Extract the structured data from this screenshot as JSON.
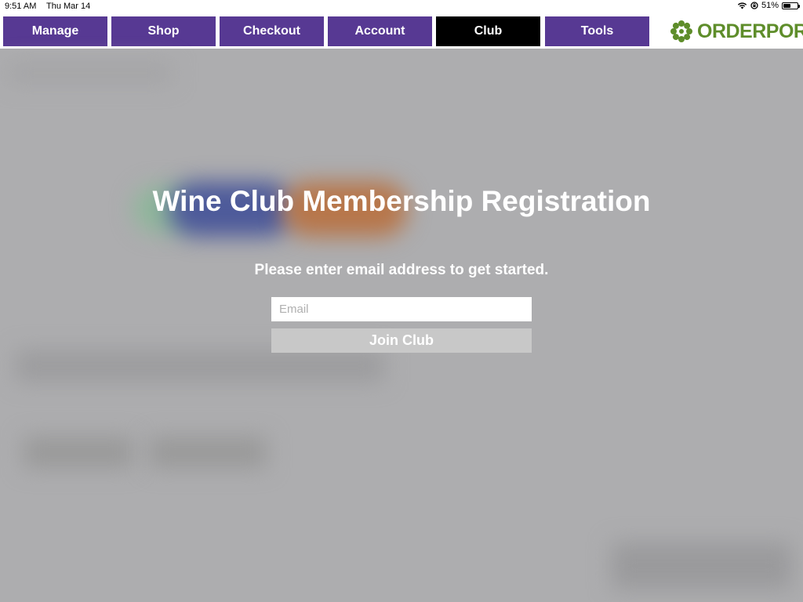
{
  "status_bar": {
    "time": "9:51 AM",
    "date": "Thu Mar 14",
    "battery_pct": "51%",
    "battery_level": 0.51,
    "wifi_icon": "wifi-icon",
    "rotation_lock_icon": "rotation-lock-icon"
  },
  "nav": {
    "tabs": [
      {
        "label": "Manage",
        "active": false
      },
      {
        "label": "Shop",
        "active": false
      },
      {
        "label": "Checkout",
        "active": false
      },
      {
        "label": "Account",
        "active": false
      },
      {
        "label": "Club",
        "active": true
      },
      {
        "label": "Tools",
        "active": false
      }
    ],
    "tab_color": "#573993",
    "active_tab_color": "#000000"
  },
  "brand": {
    "logo_text": "ORDERPORT",
    "logo_icon": "flower-logo-icon",
    "color": "#5e8d2a"
  },
  "registration": {
    "title": "Wine Club Membership Registration",
    "subtitle": "Please enter email address to get started.",
    "email_placeholder": "Email",
    "email_value": "",
    "join_label": "Join Club"
  }
}
